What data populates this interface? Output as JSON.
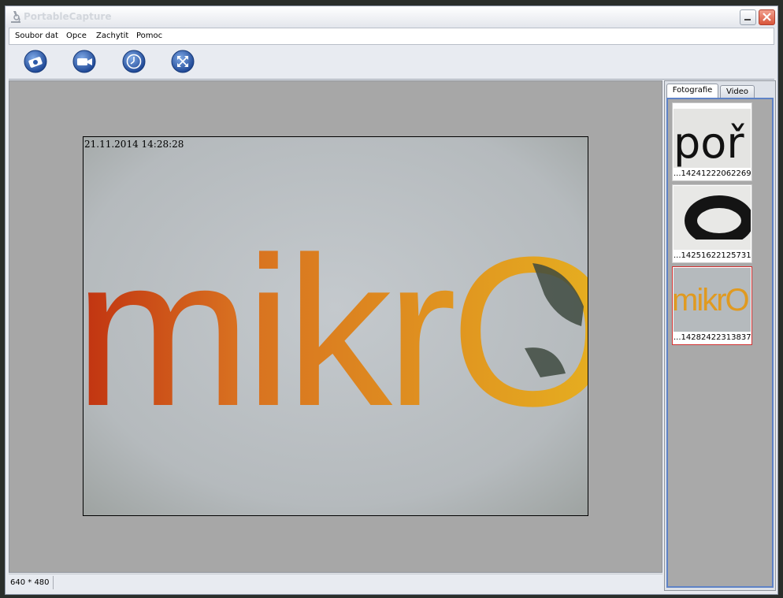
{
  "window": {
    "title": "PortableCapture"
  },
  "menu": {
    "items": [
      "Soubor dat",
      "Opce",
      "Zachytit",
      "Pomoc"
    ]
  },
  "toolbar": {
    "buttons": [
      {
        "name": "photo-capture-icon"
      },
      {
        "name": "video-camera-icon"
      },
      {
        "name": "timer-clock-icon"
      },
      {
        "name": "fullscreen-icon"
      }
    ]
  },
  "preview": {
    "timestamp": "21.11.2014 14:28:28",
    "image_text": "mikrO"
  },
  "status": {
    "resolution": "640 * 480"
  },
  "side_panel": {
    "tabs": [
      "Fotografie",
      "Video"
    ],
    "active_tab": "Fotografie",
    "thumbnails": [
      {
        "label": "...14241222062269",
        "image_text": "poř",
        "selected": false
      },
      {
        "label": "...14251622125731",
        "image_text": "",
        "selected": false
      },
      {
        "label": "...14282422313837",
        "image_text": "mikrO",
        "selected": true
      }
    ]
  },
  "colors": {
    "accent_blue": "#2d5aa8",
    "selection_red": "#d23030",
    "preview_background": "#a7a7a7"
  }
}
